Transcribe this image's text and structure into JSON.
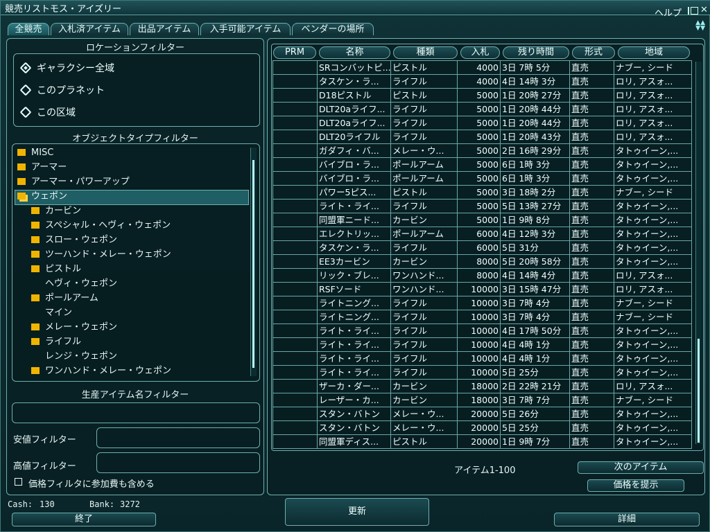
{
  "window": {
    "title": "競売リストモス・アイズリー",
    "help": "ヘルプ"
  },
  "tabs": [
    "全競売",
    "入札済アイテム",
    "出品アイテム",
    "入手可能アイテム",
    "ベンダーの場所"
  ],
  "location_filter": {
    "title": "ロケーションフィルター",
    "options": [
      "ギャラクシー全域",
      "このプラネット",
      "この区域"
    ],
    "selected": "ギャラクシー全域"
  },
  "object_filter": {
    "title": "オブジェクトタイプフィルター",
    "items": [
      {
        "label": "MISC",
        "folder": true,
        "level": 0
      },
      {
        "label": "アーマー",
        "folder": true,
        "level": 0
      },
      {
        "label": "アーマー・パワーアップ",
        "folder": true,
        "level": 0
      },
      {
        "label": "ウェポン",
        "folder": true,
        "level": 0,
        "selected": true
      },
      {
        "label": "カービン",
        "folder": true,
        "level": 1
      },
      {
        "label": "スペシャル・ヘヴィ・ウェポン",
        "folder": true,
        "level": 1
      },
      {
        "label": "スロー・ウェポン",
        "folder": true,
        "level": 1
      },
      {
        "label": "ツーハンド・メレー・ウェポン",
        "folder": true,
        "level": 1
      },
      {
        "label": "ピストル",
        "folder": true,
        "level": 1
      },
      {
        "label": "ヘヴィ・ウェポン",
        "folder": false,
        "level": 1
      },
      {
        "label": "ポールアーム",
        "folder": true,
        "level": 1
      },
      {
        "label": "マイン",
        "folder": false,
        "level": 1
      },
      {
        "label": "メレー・ウェポン",
        "folder": true,
        "level": 1
      },
      {
        "label": "ライフル",
        "folder": true,
        "level": 1
      },
      {
        "label": "レンジ・ウェポン",
        "folder": false,
        "level": 1
      },
      {
        "label": "ワンハンド・メレー・ウェポン",
        "folder": true,
        "level": 1
      }
    ]
  },
  "name_filter": {
    "title": "生産アイテム名フィルター",
    "value": ""
  },
  "min_price": {
    "label": "安値フィルター",
    "value": ""
  },
  "max_price": {
    "label": "高値フィルター",
    "value": ""
  },
  "include_fee": {
    "label": "価格フィルタに参加費も含める",
    "checked": false
  },
  "status": {
    "cash_label": "Cash:",
    "cash": "130",
    "bank_label": "Bank:",
    "bank": "3272"
  },
  "buttons": {
    "exit": "終了",
    "refresh": "更新",
    "next": "次のアイテム",
    "offer": "価格を提示",
    "details": "詳細"
  },
  "pagination": "アイテム1-100",
  "columns": [
    "PRM",
    "名称",
    "種類",
    "入札",
    "残り時間",
    "形式",
    "地域"
  ],
  "rows": [
    [
      "",
      "SRコンバットピ...",
      "ピストル",
      "4000",
      "3日 7時 5分",
      "直売",
      "ナブー, シード"
    ],
    [
      "",
      "タスケン・ラ...",
      "ライフル",
      "4000",
      "4日 14時 3分",
      "直売",
      "ロリ, アスォ..."
    ],
    [
      "",
      "D18ピストル",
      "ピストル",
      "5000",
      "1日 20時 27分",
      "直売",
      "ロリ, アスォ..."
    ],
    [
      "",
      "DLT20aライフ...",
      "ライフル",
      "5000",
      "1日 20時 44分",
      "直売",
      "ロリ, アスォ..."
    ],
    [
      "",
      "DLT20aライフ...",
      "ライフル",
      "5000",
      "1日 20時 44分",
      "直売",
      "ロリ, アスォ..."
    ],
    [
      "",
      "DLT20ライフル",
      "ライフル",
      "5000",
      "1日 20時 43分",
      "直売",
      "ロリ, アスォ..."
    ],
    [
      "",
      "ガダフィ・バ...",
      "メレー・ウ...",
      "5000",
      "2日 16時 29分",
      "直売",
      "タトゥイーン,..."
    ],
    [
      "",
      "バイブロ・ラ...",
      "ポールアーム",
      "5000",
      "6日 1時 3分",
      "直売",
      "タトゥイーン,..."
    ],
    [
      "",
      "バイブロ・ラ...",
      "ポールアーム",
      "5000",
      "6日 1時 3分",
      "直売",
      "タトゥイーン,..."
    ],
    [
      "",
      "パワー5ピス...",
      "ピストル",
      "5000",
      "3日 18時 2分",
      "直売",
      "ナブー, シード"
    ],
    [
      "",
      "ライト・ライ...",
      "ライフル",
      "5000",
      "5日 13時 27分",
      "直売",
      "タトゥイーン,..."
    ],
    [
      "",
      "同盟軍ニード...",
      "カービン",
      "5000",
      "1日 9時 8分",
      "直売",
      "タトゥイーン,..."
    ],
    [
      "",
      "エレクトリッ...",
      "ポールアーム",
      "6000",
      "4日 12時 3分",
      "直売",
      "タトゥイーン,..."
    ],
    [
      "",
      "タスケン・ラ...",
      "ライフル",
      "6000",
      "5日 31分",
      "直売",
      "タトゥイーン,..."
    ],
    [
      "",
      "EE3カービン",
      "カービン",
      "8000",
      "5日 20時 58分",
      "直売",
      "タトゥイーン,..."
    ],
    [
      "",
      "リック・ブレ...",
      "ワンハンド...",
      "8000",
      "4日 14時 4分",
      "直売",
      "ロリ, アスォ..."
    ],
    [
      "",
      "RSFソード",
      "ワンハンド...",
      "10000",
      "3日 15時 47分",
      "直売",
      "ロリ, アスォ..."
    ],
    [
      "",
      "ライトニング...",
      "ライフル",
      "10000",
      "3日 7時 4分",
      "直売",
      "ナブー, シード"
    ],
    [
      "",
      "ライトニング...",
      "ライフル",
      "10000",
      "3日 7時 4分",
      "直売",
      "ナブー, シード"
    ],
    [
      "",
      "ライト・ライ...",
      "ライフル",
      "10000",
      "4日 17時 50分",
      "直売",
      "タトゥイーン,..."
    ],
    [
      "",
      "ライト・ライ...",
      "ライフル",
      "10000",
      "4日 4時 1分",
      "直売",
      "タトゥイーン,..."
    ],
    [
      "",
      "ライト・ライ...",
      "ライフル",
      "10000",
      "4日 4時 1分",
      "直売",
      "タトゥイーン,..."
    ],
    [
      "",
      "ライト・ライ...",
      "ライフル",
      "10000",
      "5日 25分",
      "直売",
      "タトゥイーン,..."
    ],
    [
      "",
      "ザーカ・ダー...",
      "カービン",
      "18000",
      "2日 22時 21分",
      "直売",
      "ロリ, アスォ..."
    ],
    [
      "",
      "レーザー・カ...",
      "カービン",
      "18000",
      "3日 7時 7分",
      "直売",
      "ナブー, シード"
    ],
    [
      "",
      "スタン・バトン",
      "メレー・ウ...",
      "20000",
      "5日 26分",
      "直売",
      "タトゥイーン,..."
    ],
    [
      "",
      "スタン・バトン",
      "メレー・ウ...",
      "20000",
      "5日 25分",
      "直売",
      "タトゥイーン,..."
    ],
    [
      "",
      "同盟軍ディス...",
      "ピストル",
      "20000",
      "1日 9時 7分",
      "直売",
      "タトゥイーン,..."
    ]
  ],
  "colors": {
    "accent": "#6fb0b0",
    "folder": "#f0b400",
    "background": "#0a2529",
    "selection": "#1f5e64"
  }
}
